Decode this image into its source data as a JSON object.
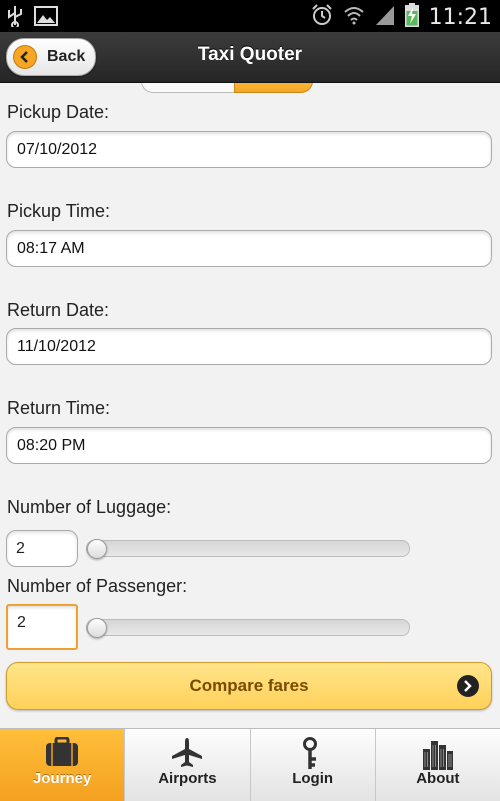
{
  "status_bar": {
    "time": "11:21",
    "icons": [
      "usb-icon",
      "image-icon",
      "alarm-icon",
      "wifi-icon",
      "signal-icon",
      "battery-charging-icon"
    ]
  },
  "header": {
    "title": "Taxi Quoter",
    "back_label": "Back"
  },
  "form": {
    "pickup_date": {
      "label": "Pickup Date:",
      "value": "07/10/2012"
    },
    "pickup_time": {
      "label": "Pickup Time:",
      "value": "08:17 AM"
    },
    "return_date": {
      "label": "Return Date:",
      "value": "11/10/2012"
    },
    "return_time": {
      "label": "Return Time:",
      "value": "08:20 PM"
    },
    "luggage": {
      "label": "Number of Luggage:",
      "value": "2"
    },
    "passenger": {
      "label": "Number of Passenger:",
      "value": "2"
    }
  },
  "compare_button": {
    "label": "Compare fares"
  },
  "tabs": [
    {
      "label": "Journey",
      "icon": "suitcase-icon",
      "active": true
    },
    {
      "label": "Airports",
      "icon": "airplane-icon",
      "active": false
    },
    {
      "label": "Login",
      "icon": "key-icon",
      "active": false
    },
    {
      "label": "About",
      "icon": "buildings-icon",
      "active": false
    }
  ],
  "colors": {
    "accent": "#f4a020",
    "button_fill": "#ffd15a",
    "header": "#2e2e2e"
  }
}
